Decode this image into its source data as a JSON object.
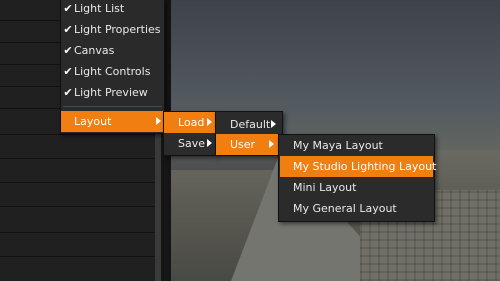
{
  "main_menu": {
    "items": [
      {
        "label": "Light List",
        "checked": true
      },
      {
        "label": "Light Properties",
        "checked": true
      },
      {
        "label": "Canvas",
        "checked": true
      },
      {
        "label": "Light Controls",
        "checked": true
      },
      {
        "label": "Light Preview",
        "checked": true
      }
    ],
    "layout_label": "Layout"
  },
  "load_menu": {
    "load_label": "Load",
    "save_label": "Save"
  },
  "default_menu": {
    "default_label": "Default",
    "user_label": "User"
  },
  "user_menu": {
    "items": [
      {
        "label": "My Maya Layout"
      },
      {
        "label": "My Studio Lighting Layout"
      },
      {
        "label": "Mini Layout"
      },
      {
        "label": "My General Layout"
      }
    ]
  },
  "colors": {
    "accent": "#f07e11",
    "menu_bg": "#2b2b2b",
    "text": "#e8e8e8"
  }
}
